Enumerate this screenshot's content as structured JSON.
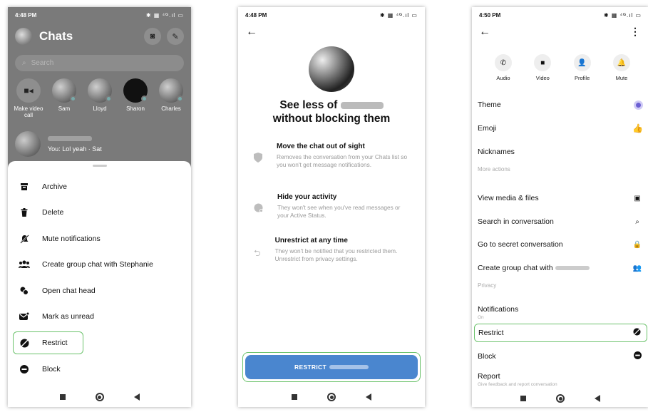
{
  "status_bar": {
    "p1_time": "4:48 PM",
    "p2_time": "4:48 PM",
    "p3_time": "4:50 PM",
    "icons": "✱ ▦ ⁴ᴳ.ıl ▭"
  },
  "chats_screen": {
    "title": "Chats",
    "search_placeholder": "Search",
    "stories": [
      {
        "name": "Make video call"
      },
      {
        "name": "Sam"
      },
      {
        "name": "Lloyd"
      },
      {
        "name": "Sharon"
      },
      {
        "name": "Charles"
      }
    ],
    "chat_preview": "You: Lol yeah · Sat",
    "menu_items": [
      {
        "label": "Archive"
      },
      {
        "label": "Delete"
      },
      {
        "label": "Mute notifications"
      },
      {
        "label": "Create group chat with Stephanie"
      },
      {
        "label": "Open chat head"
      },
      {
        "label": "Mark as unread"
      },
      {
        "label": "Restrict"
      },
      {
        "label": "Block"
      }
    ]
  },
  "restrict_screen": {
    "headline_prefix": "See less of",
    "headline_line2": "without blocking them",
    "features": [
      {
        "title": "Move the chat out of sight",
        "desc": "Removes the conversation from your Chats list so you won't get message notifications."
      },
      {
        "title": "Hide your activity",
        "desc": "They won't see when you've read messages or your Active Status."
      },
      {
        "title": "Unrestrict at any time",
        "desc": "They won't be notified that you restricted them. Unrestrict from privacy settings."
      }
    ],
    "button_label": "RESTRICT"
  },
  "settings_screen": {
    "actions": [
      {
        "label": "Audio"
      },
      {
        "label": "Video"
      },
      {
        "label": "Profile"
      },
      {
        "label": "Mute"
      }
    ],
    "theme": "Theme",
    "emoji": "Emoji",
    "nicknames": "Nicknames",
    "more_actions": "More actions",
    "view_media": "View media & files",
    "search_conv": "Search in conversation",
    "secret_conv": "Go to secret conversation",
    "group_chat": "Create group chat with",
    "privacy": "Privacy",
    "notifications": "Notifications",
    "notifications_sub": "On",
    "restrict": "Restrict",
    "block": "Block",
    "report": "Report",
    "report_sub": "Give feedback and report conversation"
  },
  "colors": {
    "highlight": "#6cc26c",
    "button_blue": "#4a86cf",
    "theme_purple": "#6b5fd3",
    "emoji_blue": "#3b7be0"
  }
}
